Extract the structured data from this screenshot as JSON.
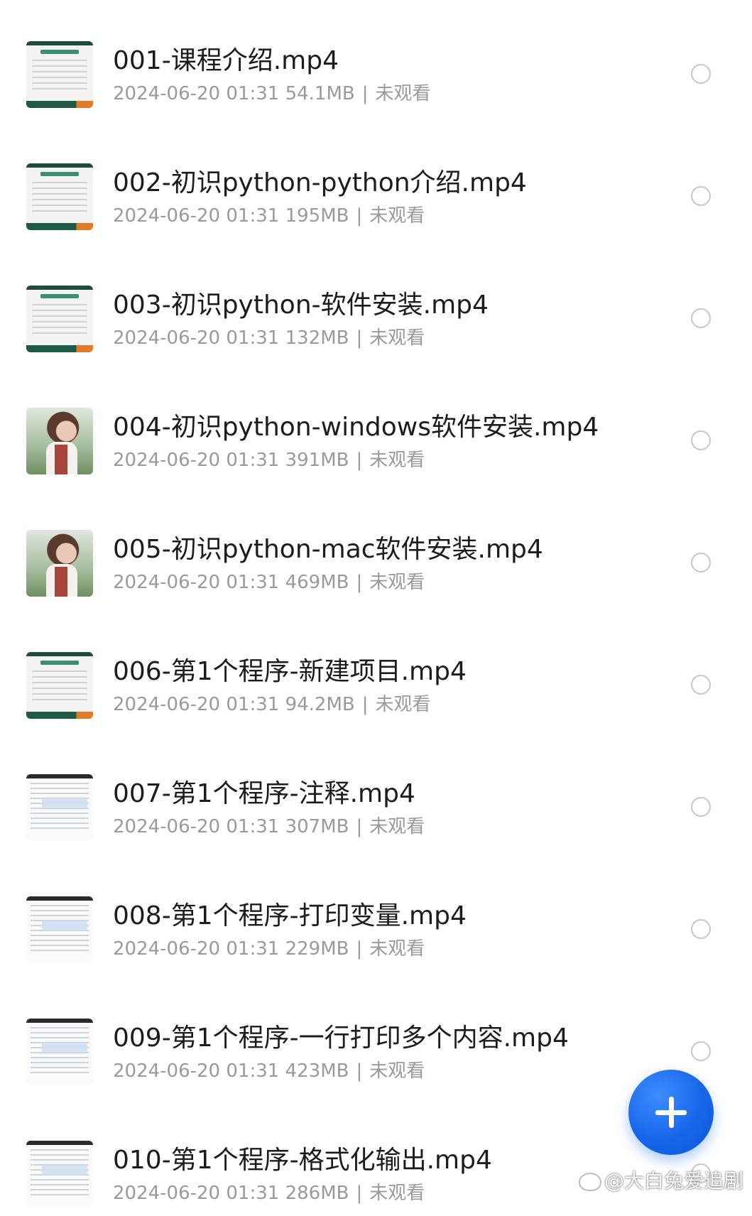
{
  "files": [
    {
      "title": "001-课程介绍.mp4",
      "date": "2024-06-20 01:31",
      "size": "54.1MB",
      "status": "未观看",
      "thumb": "slide"
    },
    {
      "title": "002-初识python-python介绍.mp4",
      "date": "2024-06-20 01:31",
      "size": "195MB",
      "status": "未观看",
      "thumb": "slide"
    },
    {
      "title": "003-初识python-软件安装.mp4",
      "date": "2024-06-20 01:31",
      "size": "132MB",
      "status": "未观看",
      "thumb": "slide"
    },
    {
      "title": "004-初识python-windows软件安装.mp4",
      "date": "2024-06-20 01:31",
      "size": "391MB",
      "status": "未观看",
      "thumb": "photo"
    },
    {
      "title": "005-初识python-mac软件安装.mp4",
      "date": "2024-06-20 01:31",
      "size": "469MB",
      "status": "未观看",
      "thumb": "photo"
    },
    {
      "title": "006-第1个程序-新建项目.mp4",
      "date": "2024-06-20 01:31",
      "size": "94.2MB",
      "status": "未观看",
      "thumb": "slide"
    },
    {
      "title": "007-第1个程序-注释.mp4",
      "date": "2024-06-20 01:31",
      "size": "307MB",
      "status": "未观看",
      "thumb": "code"
    },
    {
      "title": "008-第1个程序-打印变量.mp4",
      "date": "2024-06-20 01:31",
      "size": "229MB",
      "status": "未观看",
      "thumb": "code"
    },
    {
      "title": "009-第1个程序-一行打印多个内容.mp4",
      "date": "2024-06-20 01:31",
      "size": "423MB",
      "status": "未观看",
      "thumb": "code"
    },
    {
      "title": "010-第1个程序-格式化输出.mp4",
      "date": "2024-06-20 01:31",
      "size": "286MB",
      "status": "未观看",
      "thumb": "code"
    }
  ],
  "meta_separator": "|",
  "fab": {
    "icon": "plus-icon",
    "color": "#1766ea"
  },
  "watermark": {
    "text": "@大白兔爱追剧",
    "icon": "weibo-logo-icon"
  }
}
